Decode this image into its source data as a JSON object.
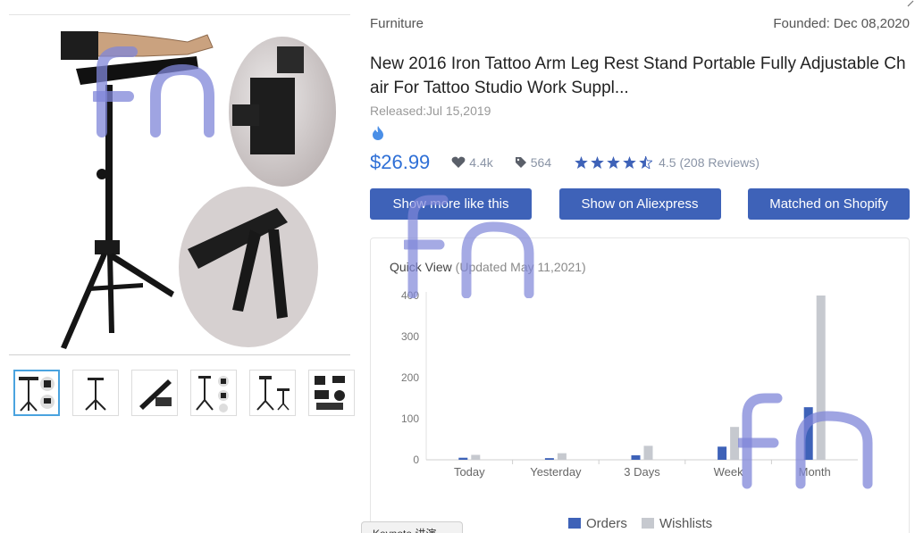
{
  "gallery": {
    "thumbnail_count": 6,
    "active_thumbnail": 0
  },
  "product": {
    "category": "Furniture",
    "founded": "Founded: Dec 08,2020",
    "title": "New 2016 Iron Tattoo Arm Leg Rest Stand Portable Fully Adjustable Chair For Tattoo Studio Work Suppl...",
    "released": "Released:Jul 15,2019",
    "price": "$26.99",
    "likes": "4.4k",
    "tags": "564",
    "rating_text": "4.5 (208 Reviews)",
    "rating_value": 4.5
  },
  "actions": {
    "more_like": "Show more like this",
    "aliexpress": "Show on Aliexpress",
    "shopify": "Matched on Shopify"
  },
  "quick_view": {
    "title": "Quick View",
    "updated": "(Updated May 11,2021)"
  },
  "chart_data": {
    "type": "bar",
    "categories": [
      "Today",
      "Yesterday",
      "3 Days",
      "Week",
      "Month"
    ],
    "series": [
      {
        "name": "Orders",
        "values": [
          5,
          4,
          11,
          32,
          128
        ],
        "color": "#3e62b8"
      },
      {
        "name": "Wishlists",
        "values": [
          12,
          16,
          34,
          80,
          400
        ],
        "color": "#c6c9cf"
      }
    ],
    "ylim": [
      0,
      400
    ],
    "yticks": [
      0,
      100,
      200,
      300,
      400
    ],
    "grid": false,
    "legend": "bottom"
  },
  "taskbar": {
    "keynote": "Keynote 讲演"
  },
  "colors": {
    "accent": "#3e62b8",
    "price": "#2e6fd6",
    "watermark": "#7f86d8"
  }
}
